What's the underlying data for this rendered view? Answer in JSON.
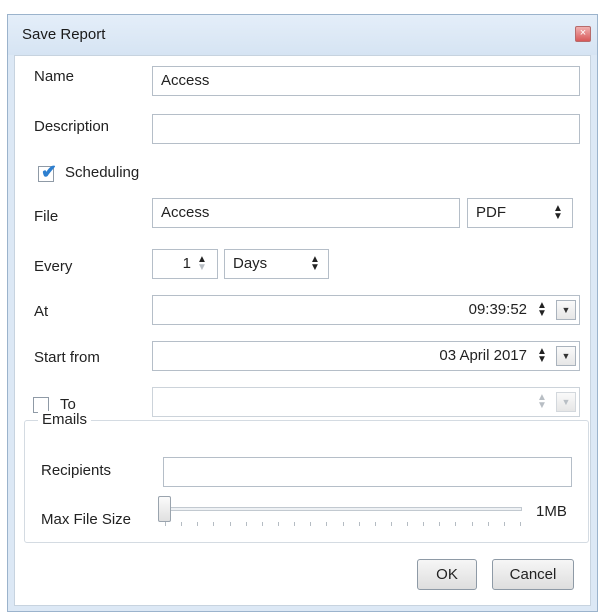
{
  "dialog": {
    "title": "Save Report",
    "close_glyph": "×"
  },
  "name": {
    "label": "Name",
    "value": "Access"
  },
  "description": {
    "label": "Description",
    "value": ""
  },
  "scheduling": {
    "label": "Scheduling",
    "checked": true
  },
  "file": {
    "label": "File",
    "value": "Access",
    "format": "PDF"
  },
  "every": {
    "label": "Every",
    "value": "1",
    "unit": "Days"
  },
  "at": {
    "label": "At",
    "value": "09:39:52"
  },
  "start_from": {
    "label": "Start from",
    "value": "03 April 2017"
  },
  "to": {
    "label": "To",
    "checked": false,
    "value": ""
  },
  "emails": {
    "group_label": "Emails",
    "recipients_label": "Recipients",
    "recipients_value": "",
    "max_file_size_label": "Max File Size",
    "max_file_size_value": "1MB",
    "slider_level": 0
  },
  "buttons": {
    "ok": "OK",
    "cancel": "Cancel"
  },
  "glyphs": {
    "spin_up": "▲",
    "spin_down": "▼",
    "dropdown": "▼"
  },
  "icons": {
    "close": "close-icon",
    "checkmark": "checkmark-icon",
    "spinner": "spinner-arrows-icon",
    "dropdown": "dropdown-arrow-icon"
  },
  "colors": {
    "checkmark": "#2d7fd0",
    "titlebar": "#dce8f5",
    "close": "#d85858"
  }
}
